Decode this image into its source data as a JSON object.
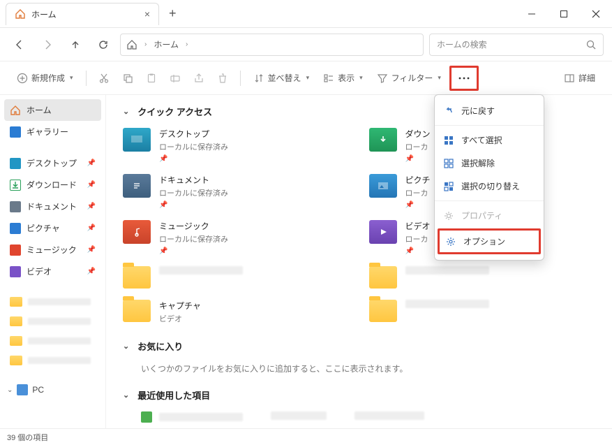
{
  "tab": {
    "title": "ホーム"
  },
  "breadcrumb": {
    "current": "ホーム"
  },
  "search": {
    "placeholder": "ホームの検索"
  },
  "toolbar": {
    "new": "新規作成",
    "sort": "並べ替え",
    "view": "表示",
    "filter": "フィルター",
    "details": "詳細"
  },
  "sidebar": {
    "home": "ホーム",
    "gallery": "ギャラリー",
    "desktop": "デスクトップ",
    "downloads": "ダウンロード",
    "documents": "ドキュメント",
    "pictures": "ピクチャ",
    "music": "ミュージック",
    "videos": "ビデオ",
    "pc": "PC"
  },
  "sections": {
    "quick_access": "クイック アクセス",
    "favorites": "お気に入り",
    "favorites_empty": "いくつかのファイルをお気に入りに追加すると、ここに表示されます。",
    "recent": "最近使用した項目"
  },
  "qa": {
    "desktop": {
      "title": "デスクトップ",
      "sub": "ローカルに保存済み"
    },
    "downloads": {
      "title": "ダウン",
      "sub": "ローカ"
    },
    "documents": {
      "title": "ドキュメント",
      "sub": "ローカルに保存済み"
    },
    "pictures": {
      "title": "ピクチ",
      "sub": "ローカ"
    },
    "music": {
      "title": "ミュージック",
      "sub": "ローカルに保存済み"
    },
    "videos": {
      "title": "ビデオ",
      "sub": "ローカ"
    },
    "captures": {
      "title": "キャプチャ",
      "sub": "ビデオ"
    }
  },
  "menu": {
    "undo": "元に戻す",
    "select_all": "すべて選択",
    "select_none": "選択解除",
    "invert_selection": "選択の切り替え",
    "properties": "プロパティ",
    "options": "オプション"
  },
  "status": {
    "items": "39 個の項目"
  }
}
